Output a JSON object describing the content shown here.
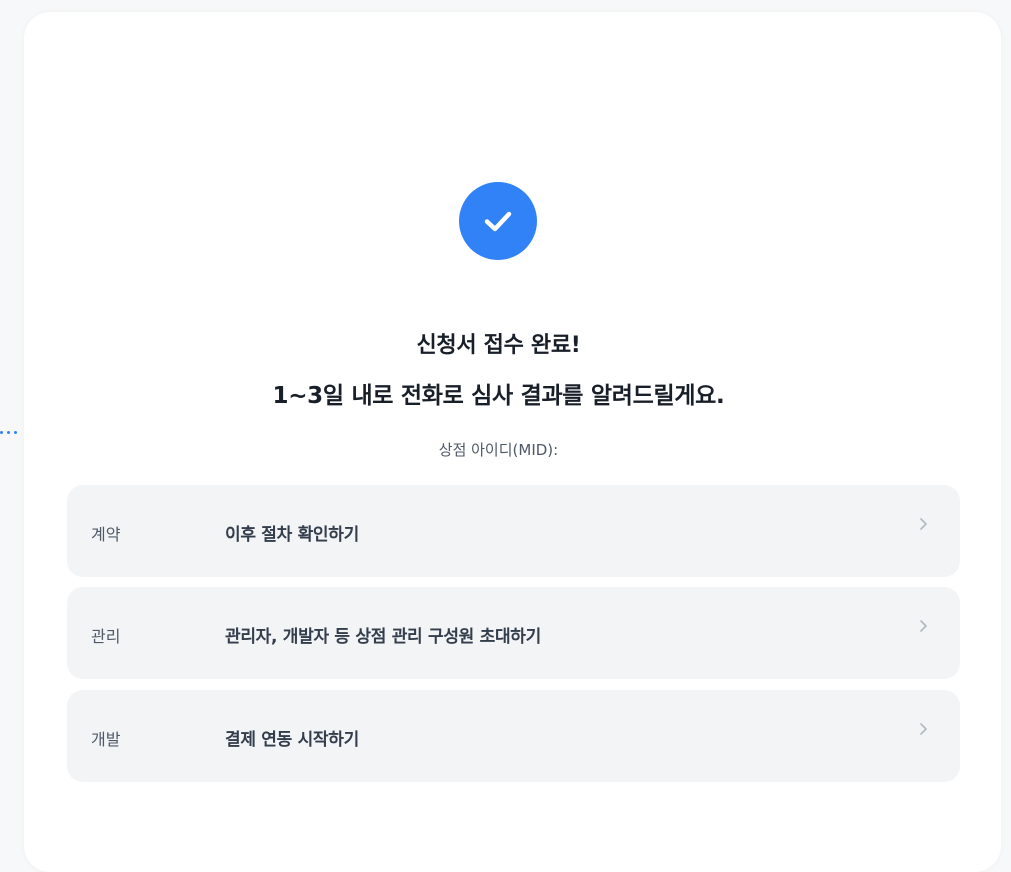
{
  "completion": {
    "title": "신청서 접수 완료!",
    "subtitle": "1~3일 내로 전화로 심사 결과를 알려드릴게요.",
    "mid_label": "상점 아이디(MID):"
  },
  "steps": [
    {
      "category": "계약",
      "label": "이후 절차 확인하기"
    },
    {
      "category": "관리",
      "label": "관리자, 개발자 등 상점 관리 구성원 초대하기"
    },
    {
      "category": "개발",
      "label": "결제 연동 시작하기"
    }
  ],
  "colors": {
    "accent": "#3182f6",
    "row_background": "#f2f4f6",
    "card_background": "#ffffff"
  },
  "icons": {
    "success": "check-circle-icon",
    "row_arrow": "chevron-right-icon"
  }
}
